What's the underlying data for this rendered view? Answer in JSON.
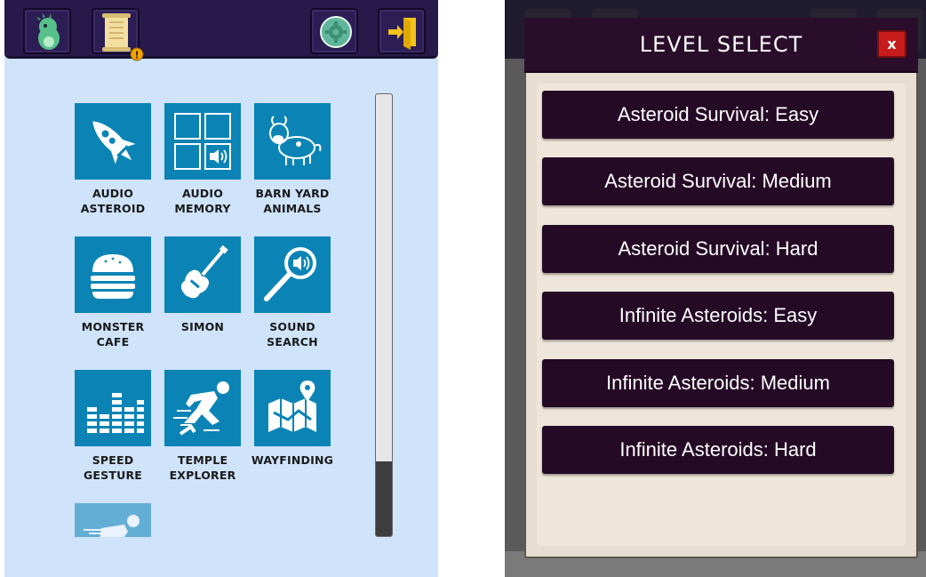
{
  "left": {
    "games": [
      {
        "label": "AUDIO\nASTEROID",
        "icon": "rocket-icon"
      },
      {
        "label": "AUDIO\nMEMORY",
        "icon": "memory-grid-icon"
      },
      {
        "label": "BARN YARD\nANIMALS",
        "icon": "cow-icon"
      },
      {
        "label": "MONSTER\nCAFE",
        "icon": "burger-icon"
      },
      {
        "label": "SIMON",
        "icon": "guitar-icon"
      },
      {
        "label": "SOUND\nSEARCH",
        "icon": "magnifier-sound-icon"
      },
      {
        "label": "SPEED\nGESTURE",
        "icon": "equalizer-icon"
      },
      {
        "label": "TEMPLE\nEXPLORER",
        "icon": "runner-icon"
      },
      {
        "label": "WAYFINDING",
        "icon": "map-pin-icon"
      }
    ],
    "quest_badge": "!"
  },
  "dialog": {
    "title": "LEVEL SELECT",
    "close_label": "x",
    "levels": [
      "Asteroid Survival: Easy",
      "Asteroid Survival: Medium",
      "Asteroid Survival: Hard",
      "Infinite Asteroids: Easy",
      "Infinite Asteroids: Medium",
      "Infinite Asteroids: Hard"
    ]
  },
  "colors": {
    "tile": "#0b84b5",
    "topbar": "#27194a",
    "level_button": "#250a26",
    "close_button": "#c81c1c",
    "background": "#cfe3fb"
  }
}
